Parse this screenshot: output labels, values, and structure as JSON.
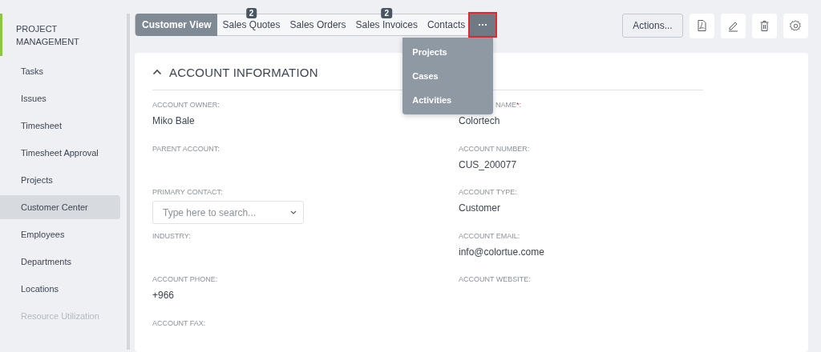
{
  "sidebar": {
    "section": "PROJECT MANAGEMENT",
    "items": [
      {
        "label": "Tasks",
        "selected": false,
        "faded": false
      },
      {
        "label": "Issues",
        "selected": false,
        "faded": false
      },
      {
        "label": "Timesheet",
        "selected": false,
        "faded": false
      },
      {
        "label": "Timesheet Approval",
        "selected": false,
        "faded": false
      },
      {
        "label": "Projects",
        "selected": false,
        "faded": false
      },
      {
        "label": "Customer Center",
        "selected": true,
        "faded": false
      },
      {
        "label": "Employees",
        "selected": false,
        "faded": false
      },
      {
        "label": "Departments",
        "selected": false,
        "faded": false
      },
      {
        "label": "Locations",
        "selected": false,
        "faded": false
      },
      {
        "label": "Resource Utilization",
        "selected": false,
        "faded": true
      }
    ]
  },
  "tabs": [
    {
      "kind": "text",
      "label": "Customer View",
      "selected": true
    },
    {
      "kind": "text",
      "label": "Sales Quotes",
      "selected": false,
      "badge": "2"
    },
    {
      "kind": "text",
      "label": "Sales Orders",
      "selected": false
    },
    {
      "kind": "text",
      "label": "Sales Invoices",
      "selected": false,
      "badge": "2"
    },
    {
      "kind": "text",
      "label": "Contacts",
      "selected": false
    },
    {
      "kind": "more",
      "label": "···",
      "selected": false,
      "expanded": true,
      "highlighted": true,
      "menu": [
        "Projects",
        "Cases",
        "Activities"
      ]
    }
  ],
  "toolbar": {
    "actions": "Actions..."
  },
  "section": {
    "title": "ACCOUNT INFORMATION",
    "expanded": true
  },
  "fields": [
    {
      "kind": "text",
      "label": "ACCOUNT OWNER:",
      "value": "Miko Bale"
    },
    {
      "kind": "text",
      "label": "NAME",
      "required_mark": "*",
      "partly_covered": true,
      "label_end": ":",
      "value": "Colortech"
    },
    {
      "kind": "text",
      "label": "PARENT ACCOUNT:"
    },
    {
      "kind": "text",
      "label": "ACCOUNT NUMBER:",
      "value": "CUS_200077"
    },
    {
      "kind": "select",
      "label": "PRIMARY CONTACT:",
      "placeholder": "Type here to search..."
    },
    {
      "kind": "text",
      "label": "ACCOUNT TYPE:",
      "value": "Customer"
    },
    {
      "kind": "text",
      "label": "INDUSTRY:"
    },
    {
      "kind": "text",
      "label": "ACCOUNT EMAIL:",
      "value": "info@colortue.come"
    },
    {
      "kind": "text",
      "label": "ACCOUNT PHONE:",
      "value": "+966"
    },
    {
      "kind": "text",
      "label": "ACCOUNT WEBSITE:"
    },
    {
      "kind": "text",
      "label": "ACCOUNT FAX:"
    }
  ]
}
